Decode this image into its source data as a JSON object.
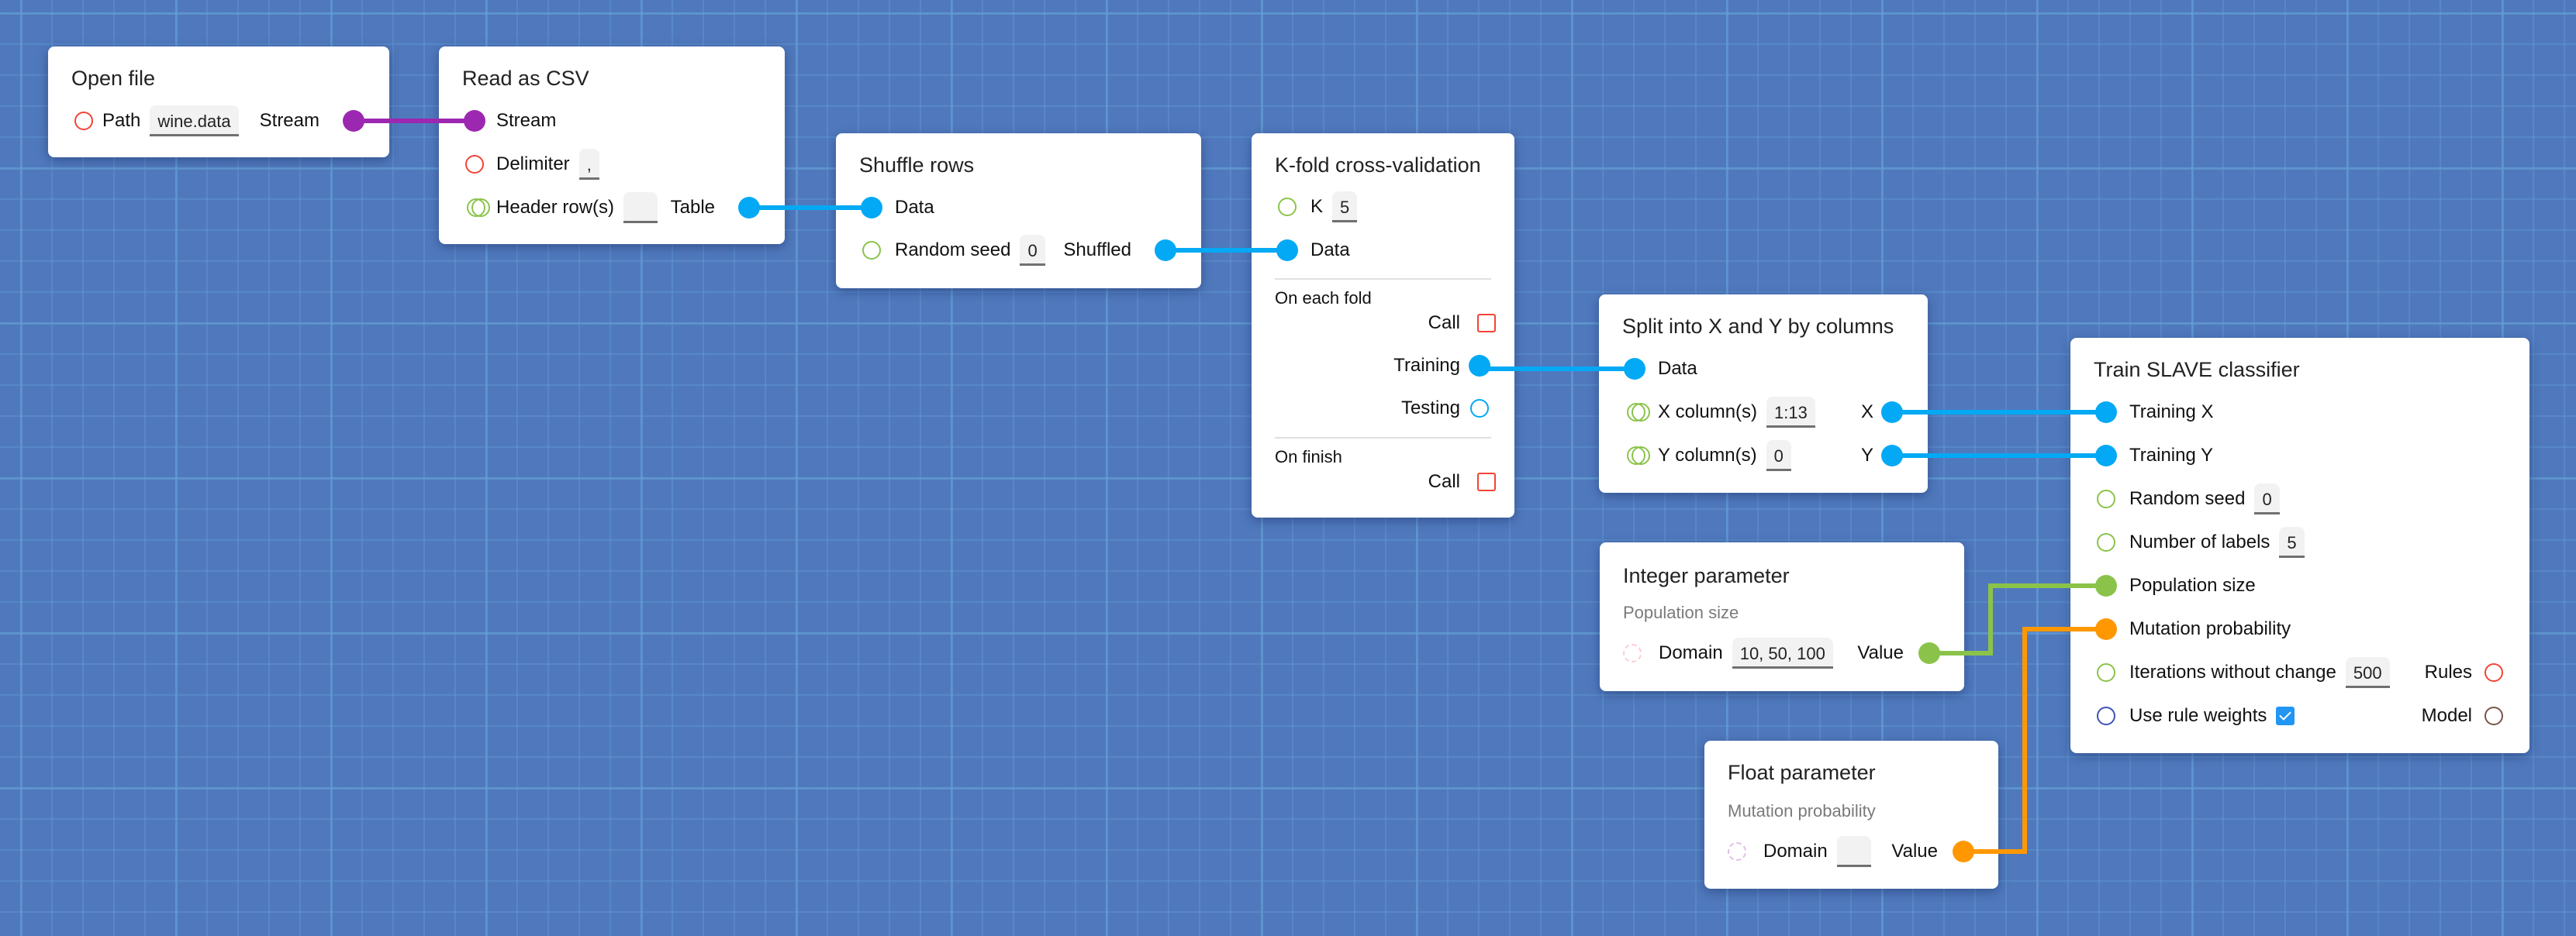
{
  "colors": {
    "canvas_bg": "#5079BD",
    "stream": "#9C27B0",
    "table": "#03A9F4",
    "integer": "#8BC34A",
    "float": "#FF9800",
    "required_unconnected": "#F44336",
    "boolean": "#3F51B5",
    "model": "#795548",
    "checkbox": "#2196F3"
  },
  "nodes": {
    "open_file": {
      "title": "Open file",
      "path_label": "Path",
      "path_value": "wine.data",
      "output_label": "Stream"
    },
    "read_csv": {
      "title": "Read as CSV",
      "input_stream_label": "Stream",
      "delimiter_label": "Delimiter",
      "delimiter_value": ",",
      "header_label": "Header row(s)",
      "header_value": "",
      "output_label": "Table"
    },
    "shuffle": {
      "title": "Shuffle rows",
      "input_label": "Data",
      "seed_label": "Random seed",
      "seed_value": "0",
      "output_label": "Shuffled"
    },
    "kfold": {
      "title": "K-fold cross-validation",
      "k_label": "K",
      "k_value": "5",
      "input_label": "Data",
      "each_fold_label": "On each fold",
      "each_call_label": "Call",
      "training_label": "Training",
      "testing_label": "Testing",
      "finish_label": "On finish",
      "finish_call_label": "Call"
    },
    "split": {
      "title": "Split into X and Y by columns",
      "input_label": "Data",
      "x_label": "X column(s)",
      "x_value": "1:13",
      "x_out": "X",
      "y_label": "Y column(s)",
      "y_value": "0",
      "y_out": "Y"
    },
    "integer_param": {
      "title": "Integer parameter",
      "subtitle": "Population size",
      "domain_label": "Domain",
      "domain_value": "10, 50, 100",
      "output_label": "Value"
    },
    "float_param": {
      "title": "Float parameter",
      "subtitle": "Mutation probability",
      "domain_label": "Domain",
      "domain_value": "",
      "output_label": "Value"
    },
    "train_slave": {
      "title": "Train SLAVE classifier",
      "training_x_label": "Training X",
      "training_y_label": "Training Y",
      "seed_label": "Random seed",
      "seed_value": "0",
      "labels_label": "Number of labels",
      "labels_value": "5",
      "population_label": "Population size",
      "mutation_label": "Mutation probability",
      "iterations_label": "Iterations without change",
      "iterations_value": "500",
      "weights_label": "Use rule weights",
      "weights_checked": true,
      "rules_label": "Rules",
      "model_label": "Model"
    }
  },
  "connections": [
    {
      "from": "open_file.Stream",
      "to": "read_csv.Stream",
      "type": "stream"
    },
    {
      "from": "read_csv.Table",
      "to": "shuffle.Data",
      "type": "table"
    },
    {
      "from": "shuffle.Shuffled",
      "to": "kfold.Data",
      "type": "table"
    },
    {
      "from": "kfold.Training",
      "to": "split.Data",
      "type": "table"
    },
    {
      "from": "split.X",
      "to": "train_slave.Training X",
      "type": "table"
    },
    {
      "from": "split.Y",
      "to": "train_slave.Training Y",
      "type": "table"
    },
    {
      "from": "integer_param.Value",
      "to": "train_slave.Population size",
      "type": "integer"
    },
    {
      "from": "float_param.Value",
      "to": "train_slave.Mutation probability",
      "type": "float"
    }
  ]
}
